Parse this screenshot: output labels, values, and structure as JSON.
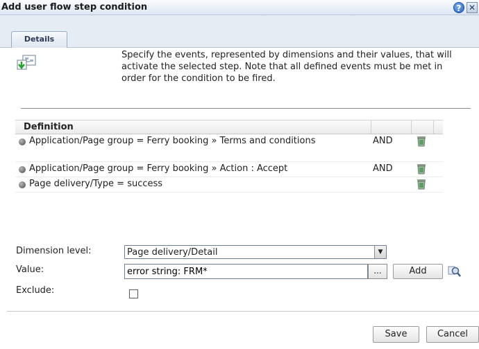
{
  "window": {
    "title": "Add user flow step condition",
    "help_icon": "question-circle-icon",
    "help_glyph": "?",
    "close_icon": "close-icon",
    "close_glyph": "✕"
  },
  "tabs": [
    {
      "label": "Details",
      "selected": true
    }
  ],
  "intro": {
    "icon": "flow-step-icon",
    "text": "Specify the events, represented by dimensions and their values, that will activate the selected step. Note that all defined events must be met in order for the condition to be fired."
  },
  "grid": {
    "columns": [
      "Definition",
      "",
      ""
    ],
    "rows": [
      {
        "definition": "Application/Page group = Ferry booking » Terms and conditions",
        "operator": "AND",
        "action_icon": "trash-icon"
      },
      {
        "definition": "Application/Page group = Ferry booking » Action : Accept",
        "operator": "AND",
        "action_icon": "trash-icon"
      },
      {
        "definition": "Page delivery/Type = success",
        "operator": "",
        "action_icon": "trash-icon"
      }
    ]
  },
  "form": {
    "dimension_level_label": "Dimension level:",
    "dimension_level_value": "Page delivery/Detail",
    "value_label": "Value:",
    "value_input": "error string: FRM*",
    "browse_label": "...",
    "add_label": "Add",
    "search_icon": "magnifier-icon",
    "exclude_label": "Exclude:",
    "exclude_checked": false
  },
  "footer": {
    "save_label": "Save",
    "cancel_label": "Cancel"
  },
  "colors": {
    "title_bar": "#dde6f2",
    "tab_strip": "#e6ecf4",
    "help_blue": "#2160c4"
  }
}
